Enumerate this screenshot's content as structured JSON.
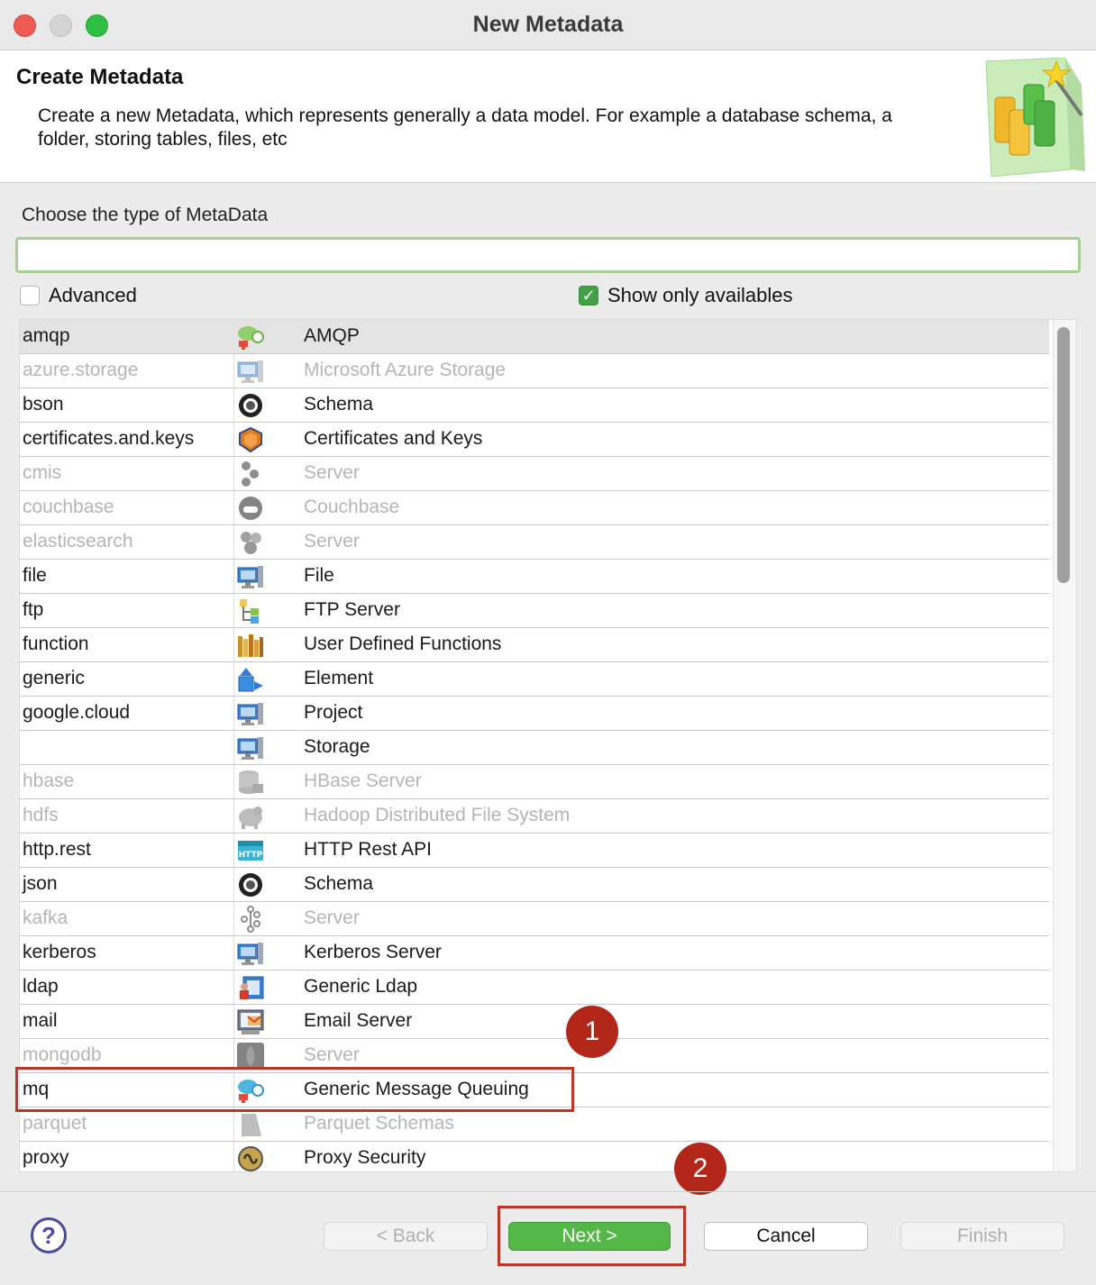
{
  "window": {
    "title": "New Metadata"
  },
  "header": {
    "title": "Create Metadata",
    "description": "Create a new Metadata, which represents generally a data model. For example a database schema, a folder, storing tables, files, etc"
  },
  "chooser": {
    "label": "Choose the type of MetaData",
    "filter_value": "",
    "advanced_label": "Advanced",
    "advanced_checked": false,
    "show_available_label": "Show only availables",
    "show_available_checked": true
  },
  "rows": [
    {
      "key": "amqp",
      "label": "AMQP",
      "icon": "amqp-icon",
      "enabled": true,
      "selected": true
    },
    {
      "key": "azure.storage",
      "label": "Microsoft Azure Storage",
      "icon": "computer-icon",
      "enabled": false
    },
    {
      "key": "bson",
      "label": "Schema",
      "icon": "schema-ring-icon",
      "enabled": true
    },
    {
      "key": "certificates.and.keys",
      "label": "Certificates and Keys",
      "icon": "shield-icon",
      "enabled": true
    },
    {
      "key": "cmis",
      "label": "Server",
      "icon": "server-stack-icon",
      "enabled": false
    },
    {
      "key": "couchbase",
      "label": "Couchbase",
      "icon": "couchbase-icon",
      "enabled": false
    },
    {
      "key": "elasticsearch",
      "label": "Server",
      "icon": "cluster-icon",
      "enabled": false
    },
    {
      "key": "file",
      "label": "File",
      "icon": "computer-icon",
      "enabled": true
    },
    {
      "key": "ftp",
      "label": "FTP Server",
      "icon": "ftp-tree-icon",
      "enabled": true
    },
    {
      "key": "function",
      "label": "User Defined Functions",
      "icon": "books-icon",
      "enabled": true
    },
    {
      "key": "generic",
      "label": "Element",
      "icon": "element-arrow-icon",
      "enabled": true
    },
    {
      "key": "google.cloud",
      "label": "Project",
      "icon": "computer-icon",
      "enabled": true
    },
    {
      "key": "",
      "label": "Storage",
      "icon": "computer-icon",
      "enabled": true
    },
    {
      "key": "hbase",
      "label": "HBase Server",
      "icon": "database-icon",
      "enabled": false
    },
    {
      "key": "hdfs",
      "label": "Hadoop Distributed File System",
      "icon": "hadoop-icon",
      "enabled": false
    },
    {
      "key": "http.rest",
      "label": "HTTP Rest API",
      "icon": "http-icon",
      "enabled": true
    },
    {
      "key": "json",
      "label": "Schema",
      "icon": "schema-ring-icon",
      "enabled": true
    },
    {
      "key": "kafka",
      "label": "Server",
      "icon": "kafka-icon",
      "enabled": false
    },
    {
      "key": "kerberos",
      "label": "Kerberos Server",
      "icon": "computer-icon",
      "enabled": true
    },
    {
      "key": "ldap",
      "label": "Generic Ldap",
      "icon": "ldap-icon",
      "enabled": true
    },
    {
      "key": "mail",
      "label": "Email Server",
      "icon": "email-icon",
      "enabled": true
    },
    {
      "key": "mongodb",
      "label": "Server",
      "icon": "mongodb-leaf-icon",
      "enabled": false
    },
    {
      "key": "mq",
      "label": "Generic Message Queuing",
      "icon": "mq-icon",
      "enabled": true
    },
    {
      "key": "parquet",
      "label": "Parquet Schemas",
      "icon": "parquet-icon",
      "enabled": false
    },
    {
      "key": "proxy",
      "label": "Proxy Security",
      "icon": "proxy-icon",
      "enabled": true
    }
  ],
  "annotations": {
    "badge1": "1",
    "badge2": "2"
  },
  "buttons": {
    "help": "?",
    "back": "< Back",
    "next": "Next >",
    "cancel": "Cancel",
    "finish": "Finish"
  },
  "colors": {
    "accent_green": "#55b747",
    "annotation_red": "#b3271b",
    "disabled_text": "#b5b5b5"
  }
}
